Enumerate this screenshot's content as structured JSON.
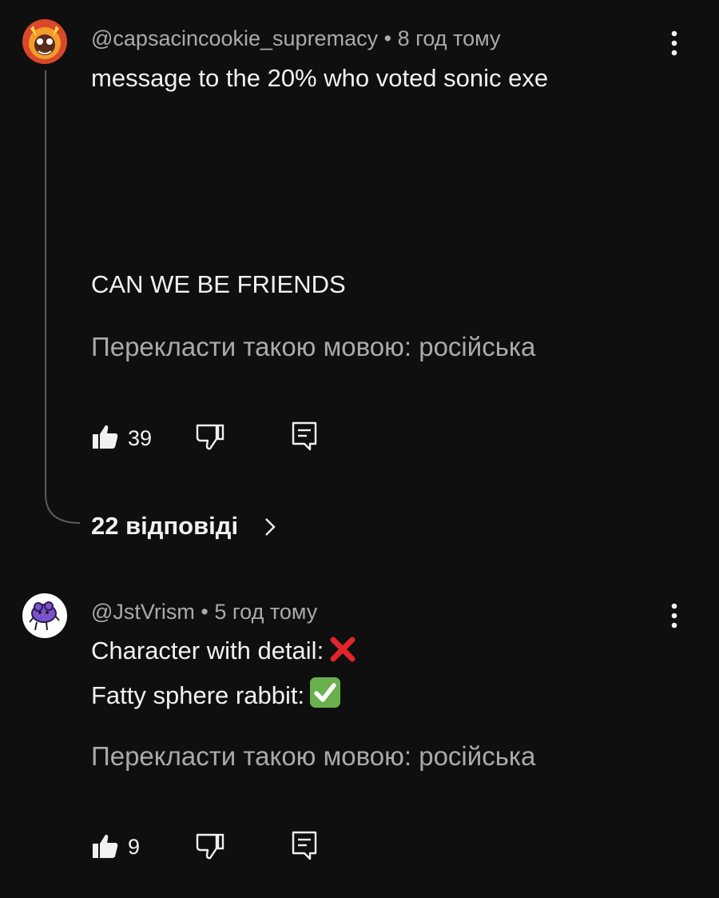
{
  "comments": [
    {
      "author": "@capsacincookie_supremacy",
      "time": "8 год тому",
      "line1": "message to the 20% who voted sonic exe",
      "line2": "CAN WE BE FRIENDS",
      "translate": "Перекласти такою мовою: російська",
      "likes": "39",
      "replies": "22 відповіді"
    },
    {
      "author": "@JstVrism",
      "time": "5 год тому",
      "line1": "Character with detail:",
      "line1_emoji": "cross-mark-emoji",
      "line2": "Fatty sphere rabbit:",
      "line2_emoji": "check-mark-emoji",
      "translate": "Перекласти такою мовою: російська",
      "likes": "9"
    }
  ],
  "separator": "•",
  "icons": [
    "more-vert-icon",
    "thumb-up-icon",
    "thumb-down-icon",
    "reply-icon",
    "chevron-right-icon"
  ],
  "colors": {
    "background": "#0f0f0f",
    "primary_text": "#f1f1f1",
    "secondary_text": "#aaaaaa",
    "thread_line": "#5a5a5a",
    "cross_red": "#e0262b",
    "check_green": "#6ab04c"
  }
}
